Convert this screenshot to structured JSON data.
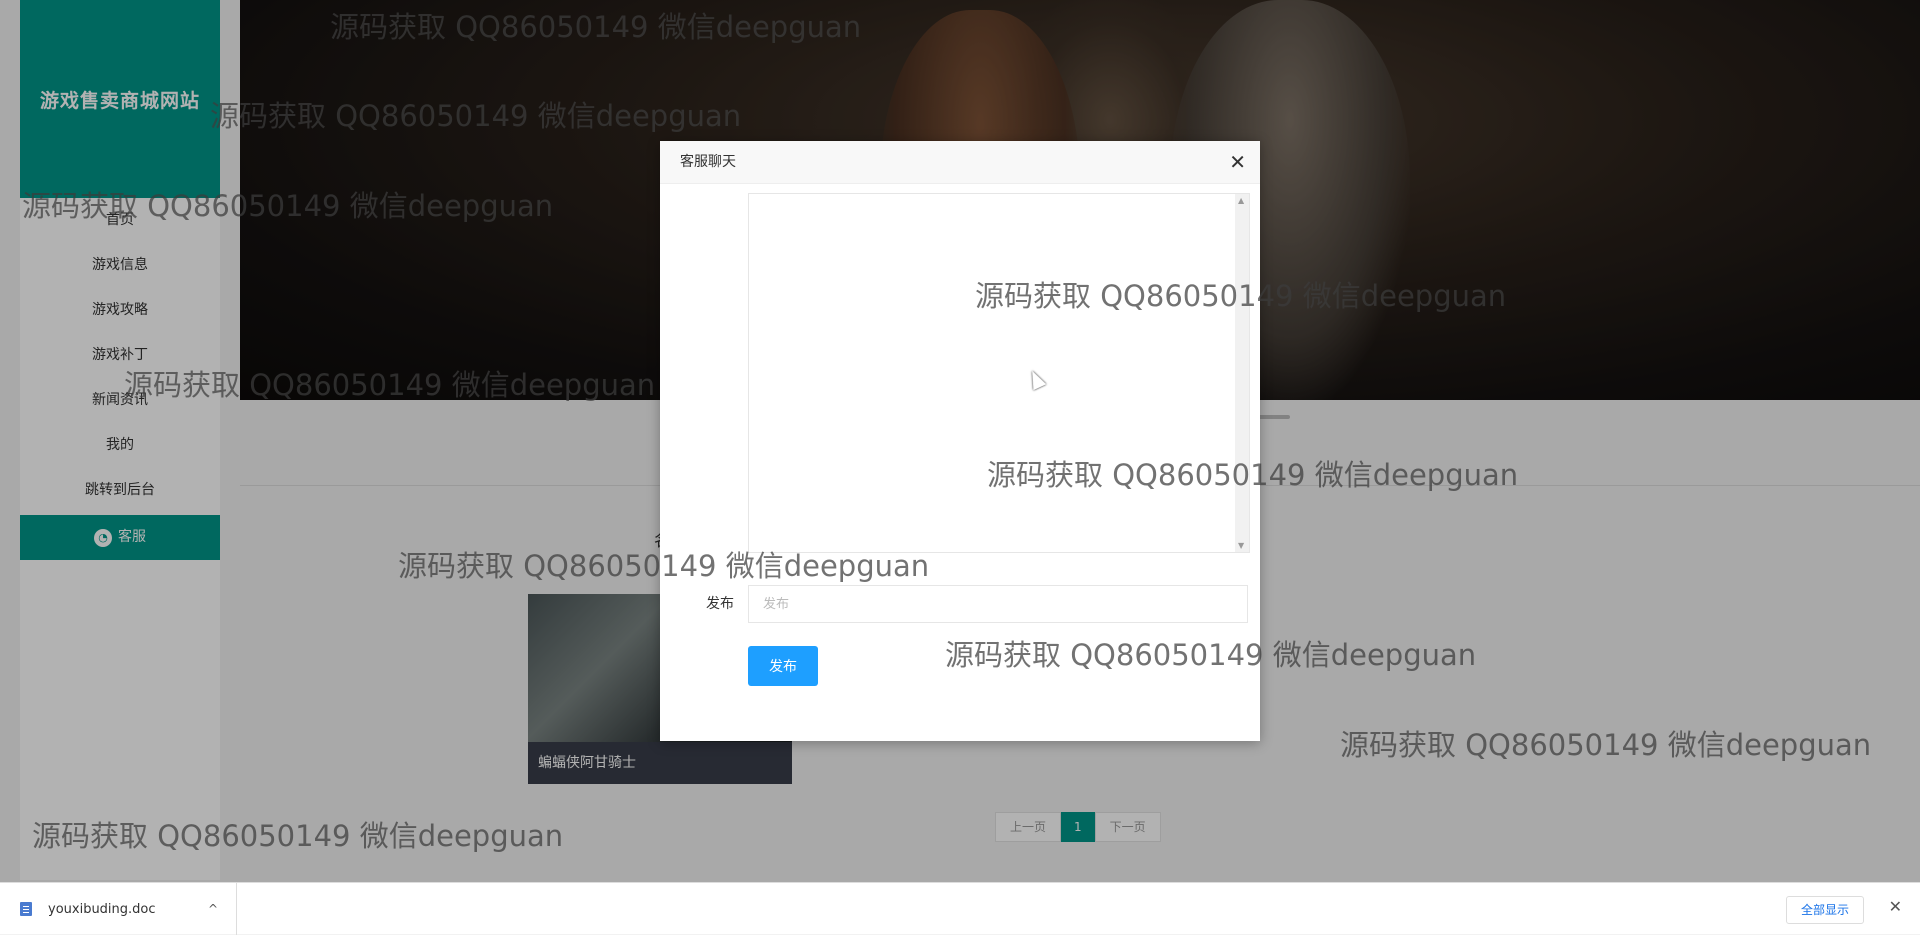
{
  "site": {
    "logo_text": "游戏售卖商城网站"
  },
  "nav": {
    "items": [
      "首页",
      "游戏信息",
      "游戏攻略",
      "游戏补丁",
      "新闻资讯",
      "我的",
      "跳转到后台"
    ],
    "service_label": "客服"
  },
  "main": {
    "section_label": "名",
    "card_title": "蝙蝠侠阿甘骑士",
    "pager": {
      "prev": "上一页",
      "current": "1",
      "next": "下一页"
    }
  },
  "modal": {
    "title": "客服聊天",
    "close_symbol": "✕",
    "input_label": "发布",
    "input_placeholder": "发布",
    "send_label": "发布",
    "scroll_up": "▲",
    "scroll_down": "▼"
  },
  "watermark": "源码获取 QQ86050149 微信deepguan",
  "download_bar": {
    "file_name": "youxibuding.doc",
    "caret": "^",
    "show_all": "全部显示",
    "close_symbol": "✕"
  },
  "colors": {
    "accent": "#009688",
    "button": "#1e9fff",
    "card_title_bg": "#393d49"
  }
}
